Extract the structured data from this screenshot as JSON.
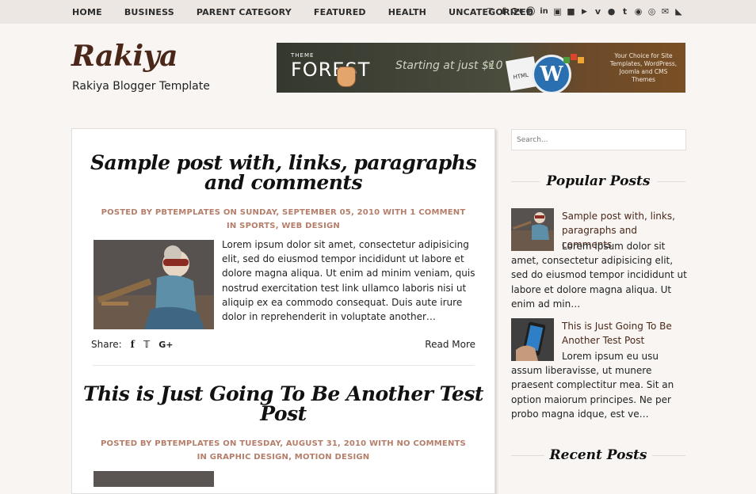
{
  "nav": {
    "items": [
      "HOME",
      "BUSINESS",
      "PARENT CATEGORY",
      "FEATURED",
      "HEALTH",
      "UNCATEGORIZED"
    ],
    "social_icons": [
      "twitter-icon",
      "facebook-icon",
      "google-plus-icon",
      "pinterest-icon",
      "linkedin-icon",
      "instagram-icon",
      "flickr-icon",
      "youtube-icon",
      "vimeo-icon",
      "github-icon",
      "tumblr-icon",
      "reddit-icon",
      "dribbble-icon",
      "email-icon",
      "rss-icon"
    ]
  },
  "site": {
    "title": "Rakiya",
    "tagline": "Rakiya Blogger Template"
  },
  "banner": {
    "brand_small": "THEME",
    "brand_big": "FOREST",
    "headline": "Starting at just $10",
    "paper_label": "HTML",
    "right_text": "Your Choice for Site Templates, WordPress, Joomla and CMS Themes"
  },
  "posts": [
    {
      "title": "Sample post with, links, paragraphs and comments",
      "meta_line1": "POSTED BY PBTEMPLATES ON SUNDAY, SEPTEMBER 05, 2010 WITH 1 COMMENT",
      "meta_line2": "IN SPORTS, WEB DESIGN",
      "excerpt": "Lorem ipsum dolor sit amet, consectetur adipisicing elit, sed do eiusmod tempor incididunt ut labore et dolore magna aliqua. Ut enim ad minim veniam, quis nostrud exercitation test link ullamco laboris nisi ut aliquip ex ea commodo consequat. Duis aute irure dolor in reprehenderit in voluptate another…",
      "share_label": "Share:",
      "read_more": "Read More"
    },
    {
      "title": "This is Just Going To Be Another Test Post",
      "meta_line1": "POSTED BY PBTEMPLATES ON TUESDAY, AUGUST 31, 2010 WITH NO COMMENTS",
      "meta_line2": "IN GRAPHIC DESIGN, MOTION DESIGN"
    }
  ],
  "sidebar": {
    "search_placeholder": "Search...",
    "popular_title": "Popular Posts",
    "popular": [
      {
        "title": "Sample post with, links, paragraphs and comments",
        "snippet": "Lorem ipsum dolor sit amet, consectetur adipisicing elit, sed do eiusmod tempor incididunt ut labore et dolore magna aliqua. Ut enim ad min…"
      },
      {
        "title": "This is Just Going To Be Another Test Post",
        "snippet": "Lorem ipsum eu usu assum liberavisse, ut munere praesent complectitur mea. Sit an option maiorum principes. Ne per probo magna idque, est ve…"
      }
    ],
    "recent_title": "Recent Posts"
  },
  "colors": {
    "accent": "#b57e6a",
    "logo": "#4a2719",
    "topbar": "#ede7e3",
    "background": "#f8f5f3"
  }
}
